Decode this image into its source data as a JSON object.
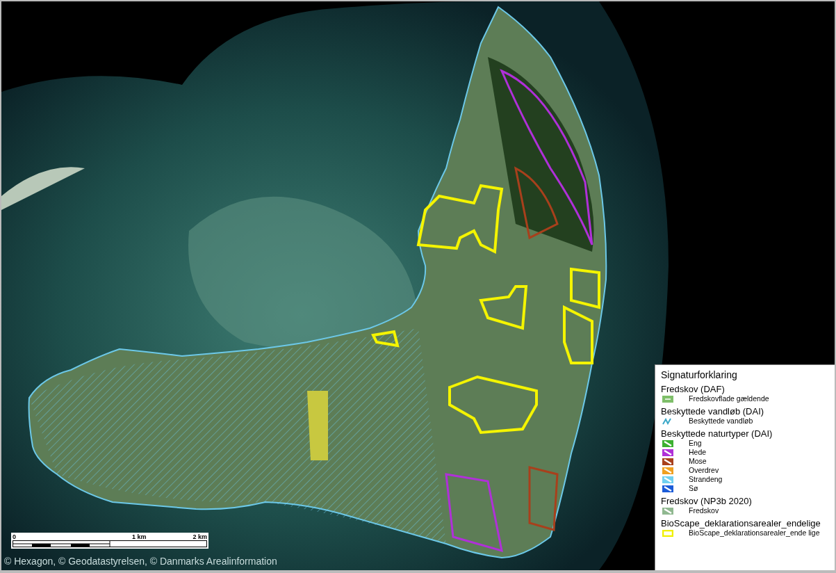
{
  "legend": {
    "title": "Signaturforklaring",
    "groups": [
      {
        "title": "Fredskov (DAF)",
        "items": [
          {
            "label": "Fredskovflade gældende",
            "kind": "fill",
            "color": "#7fbf6a"
          }
        ]
      },
      {
        "title": "Beskyttede vandløb (DAI)",
        "items": [
          {
            "label": "Beskyttede vandløb",
            "kind": "stream",
            "color": "#3aa8c8"
          }
        ]
      },
      {
        "title": "Beskyttede naturtyper (DAI)",
        "items": [
          {
            "label": "Eng",
            "kind": "hatch",
            "color": "#3cb030"
          },
          {
            "label": "Hede",
            "kind": "hatch",
            "color": "#b030d8"
          },
          {
            "label": "Mose",
            "kind": "hatch",
            "color": "#a8401c"
          },
          {
            "label": "Overdrev",
            "kind": "hatch",
            "color": "#f0a020"
          },
          {
            "label": "Strandeng",
            "kind": "hatch",
            "color": "#70d0f0"
          },
          {
            "label": "Sø",
            "kind": "hatch",
            "color": "#1c5cd8"
          }
        ]
      },
      {
        "title": "Fredskov (NP3b 2020)",
        "items": [
          {
            "label": "Fredskov",
            "kind": "hatch",
            "color": "#90b890"
          }
        ]
      },
      {
        "title": "BioScape_deklarationsarealer_endelige",
        "items": [
          {
            "label": "BioScape_deklarationsarealer_ende lige",
            "kind": "outline",
            "color": "#f0f000"
          }
        ]
      }
    ]
  },
  "scale_bar": {
    "labels": [
      "0",
      "1 km",
      "2 km"
    ]
  },
  "attribution": "© Hexagon, © Geodatastyrelsen, © Danmarks Arealinformation"
}
